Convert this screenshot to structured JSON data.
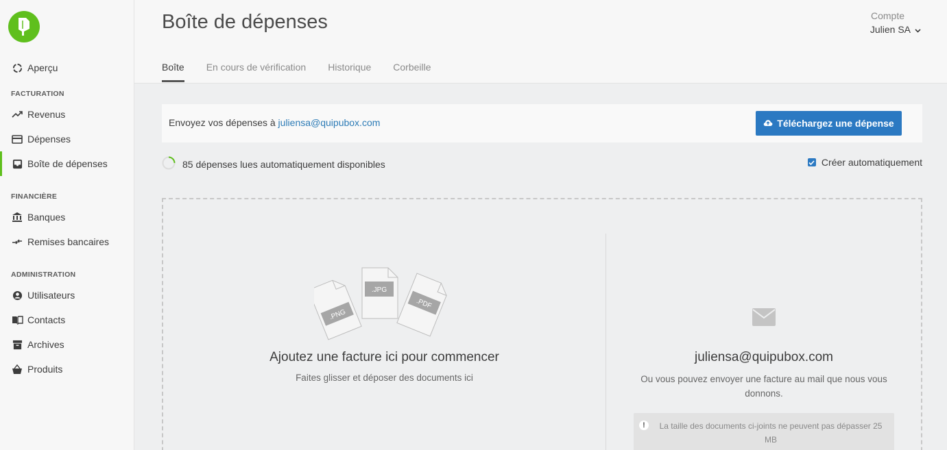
{
  "sidebar": {
    "items": [
      {
        "label": "Aperçu",
        "icon": "overview-icon"
      },
      {
        "label": "Revenus",
        "icon": "trending-up-icon"
      },
      {
        "label": "Dépenses",
        "icon": "card-icon"
      },
      {
        "label": "Boîte de dépenses",
        "icon": "inbox-icon"
      },
      {
        "label": "Banques",
        "icon": "bank-icon"
      },
      {
        "label": "Remises bancaires",
        "icon": "transfer-icon"
      },
      {
        "label": "Utilisateurs",
        "icon": "user-circle-icon"
      },
      {
        "label": "Contacts",
        "icon": "contacts-book-icon"
      },
      {
        "label": "Archives",
        "icon": "archive-icon"
      },
      {
        "label": "Produits",
        "icon": "basket-icon"
      }
    ],
    "sections": [
      "FACTURATION",
      "FINANCIÈRE",
      "ADMINISTRATION"
    ]
  },
  "header": {
    "title": "Boîte de dépenses",
    "account_label": "Compte",
    "account_name": "Julien SA"
  },
  "tabs": [
    "Boîte",
    "En cours de vérification",
    "Historique",
    "Corbeille"
  ],
  "info": {
    "text": "Envoyez vos dépenses à ",
    "email": "juliensa@quipubox.com",
    "upload_label": "Téléchargez une dépense"
  },
  "status": {
    "text": "85 dépenses lues automatiquement disponibles",
    "auto_create_label": "Créer automatiquement",
    "auto_create_checked": true
  },
  "dropzone": {
    "file_labels": [
      ".PNG",
      ".JPG",
      ".PDF"
    ],
    "left_title": "Ajoutez une facture ici pour commencer",
    "left_sub": "Faites glisser et déposer des documents ici",
    "right_title": "juliensa@quipubox.com",
    "right_sub": "Ou vous pouvez envoyer une facture au mail que nous vous donnons.",
    "warning": "La taille des documents ci-joints ne peuvent pas dépasser 25 MB"
  },
  "colors": {
    "brand": "#5fbf1d",
    "primary_button": "#2b79c2",
    "link": "#2c7bb6"
  }
}
